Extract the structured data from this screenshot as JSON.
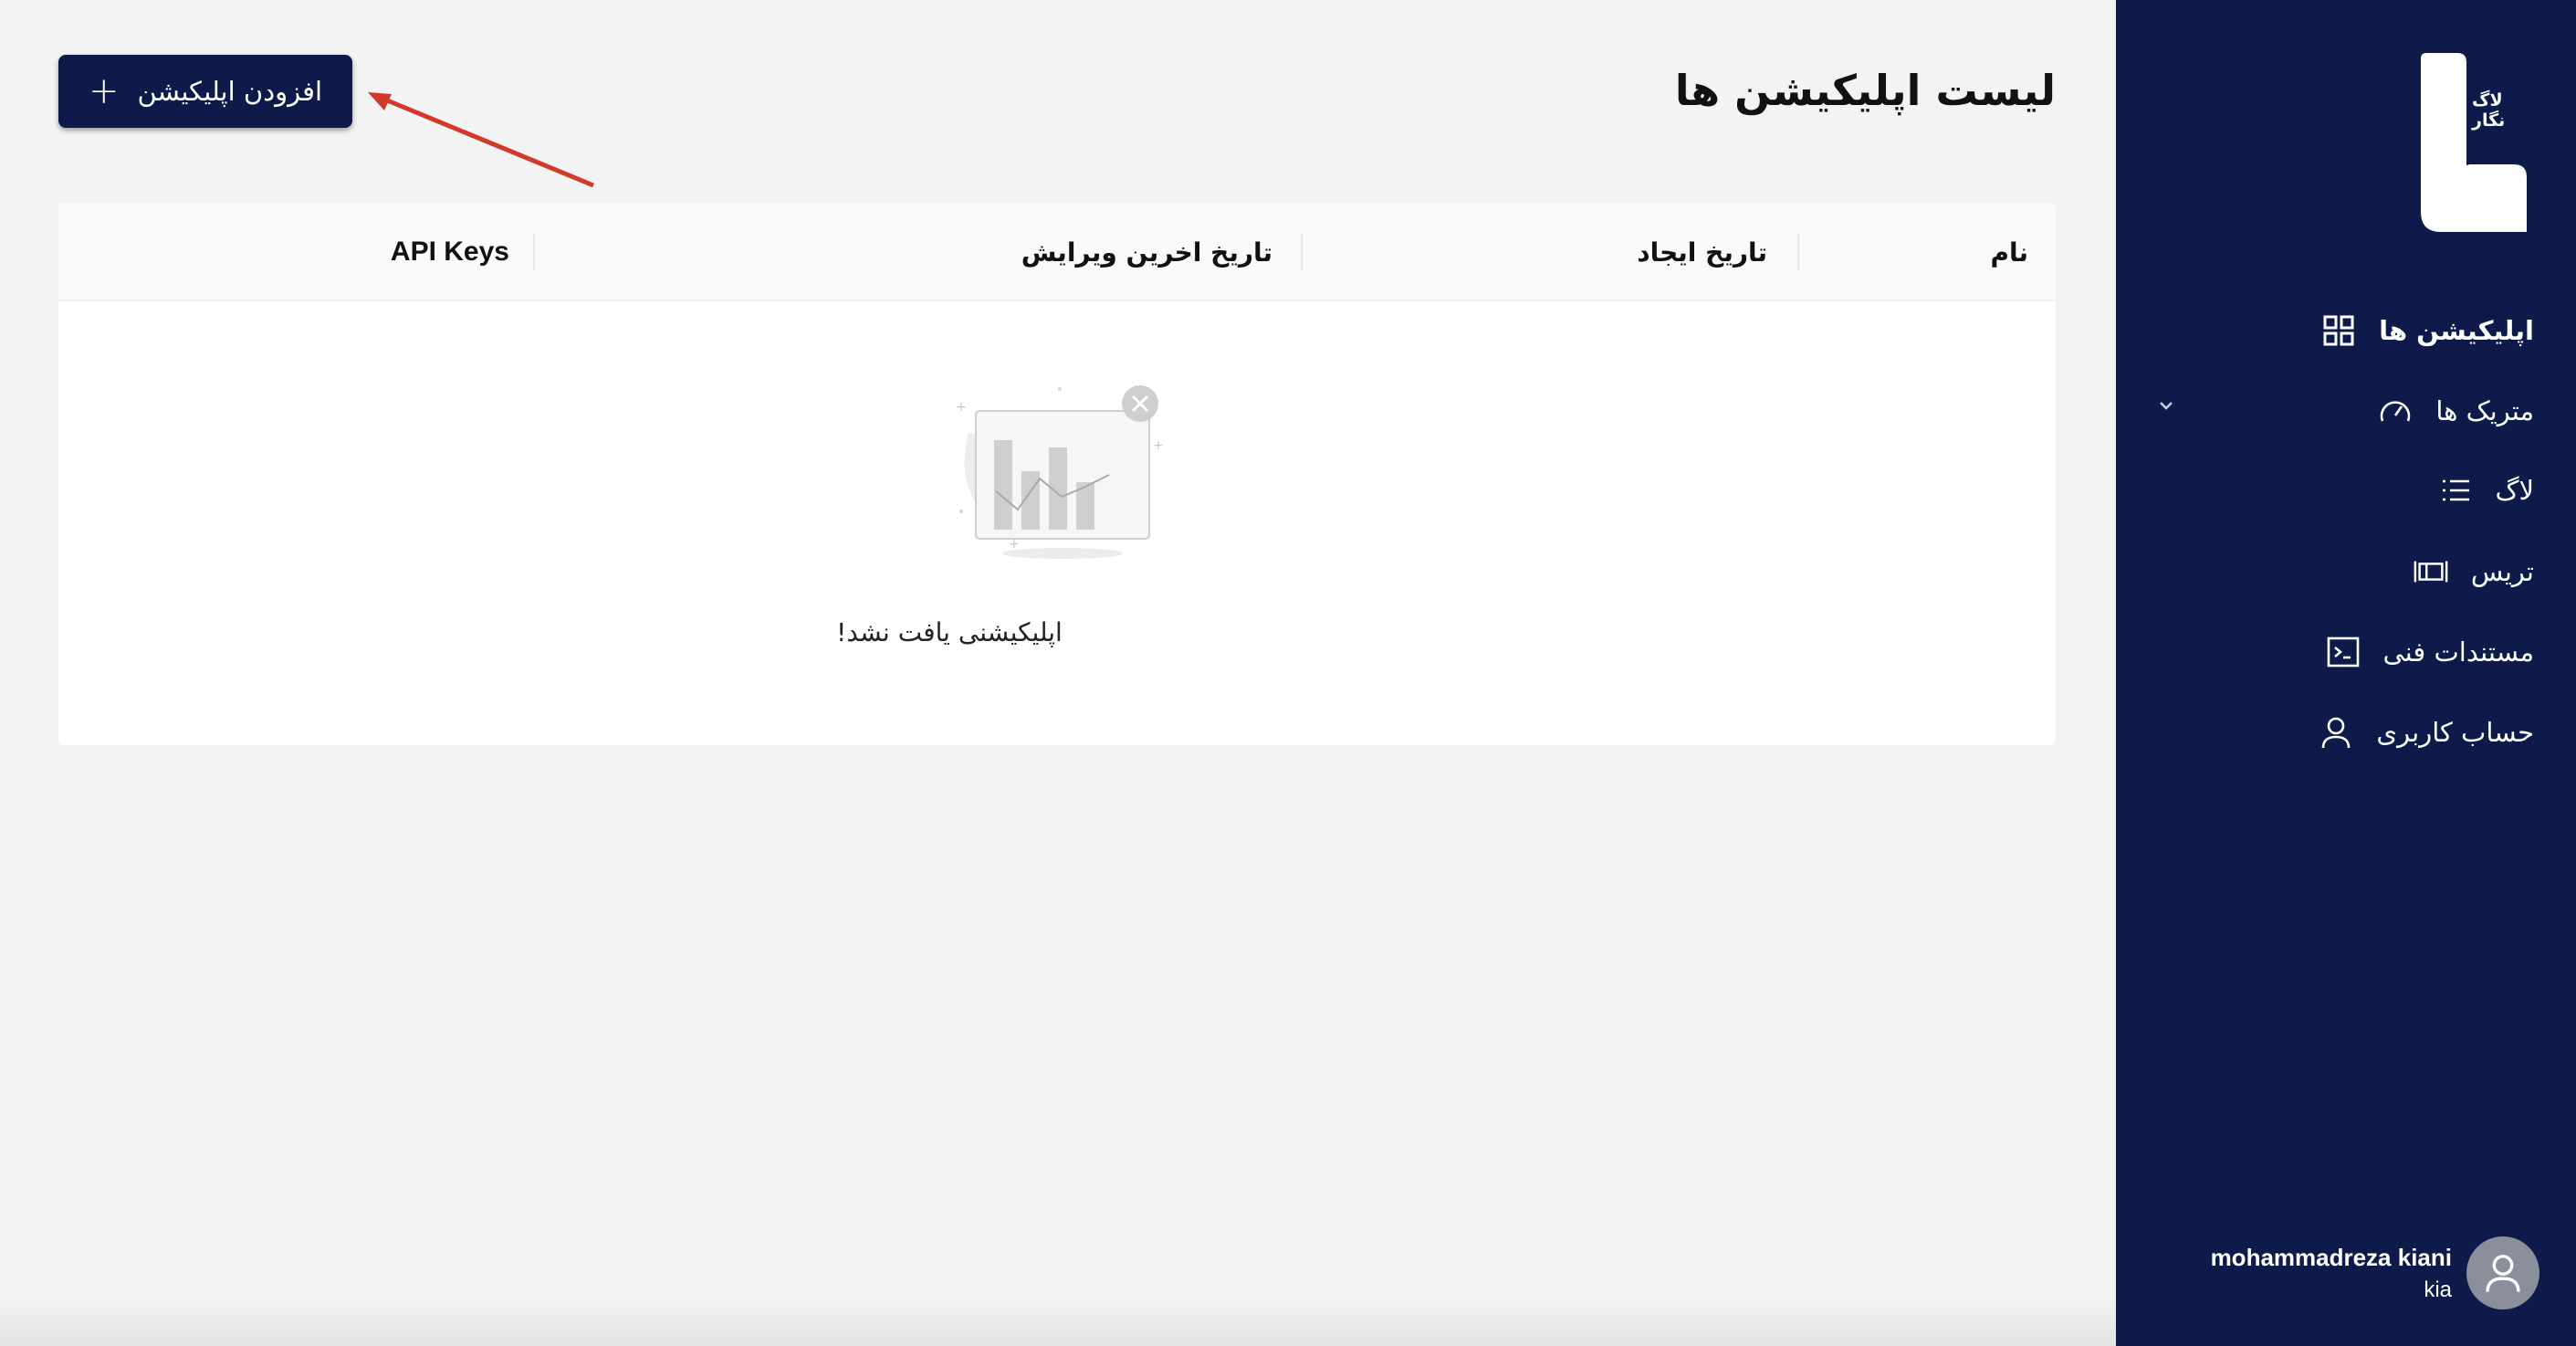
{
  "sidebar": {
    "logo_text": [
      "لاگ",
      "نگار"
    ],
    "items": [
      {
        "label": "اپلیکیشن ها",
        "icon": "grid-icon",
        "active": true
      },
      {
        "label": "متریک ها",
        "icon": "gauge-icon",
        "has_submenu": true
      },
      {
        "label": "لاگ",
        "icon": "list-icon"
      },
      {
        "label": "تریس",
        "icon": "trace-icon"
      },
      {
        "label": "مستندات فنی",
        "icon": "terminal-icon"
      },
      {
        "label": "حساب کاربری",
        "icon": "user-icon"
      }
    ],
    "user": {
      "name": "mohammadreza kiani",
      "handle": "kia"
    }
  },
  "main": {
    "title": "لیست اپلیکیشن ها",
    "add_button_label": "افزودن اپلیکیشن",
    "table": {
      "columns": [
        "نام",
        "تاریخ ایجاد",
        "تاریخ اخرین ویرایش",
        "API Keys"
      ],
      "rows": [],
      "empty_message": "اپلیکیشنی یافت نشد!"
    }
  },
  "colors": {
    "sidebar_bg": "#0d1a4a",
    "button_bg": "#0d1a4a",
    "page_bg": "#f3f3f3",
    "annotation_arrow": "#d0392b"
  }
}
